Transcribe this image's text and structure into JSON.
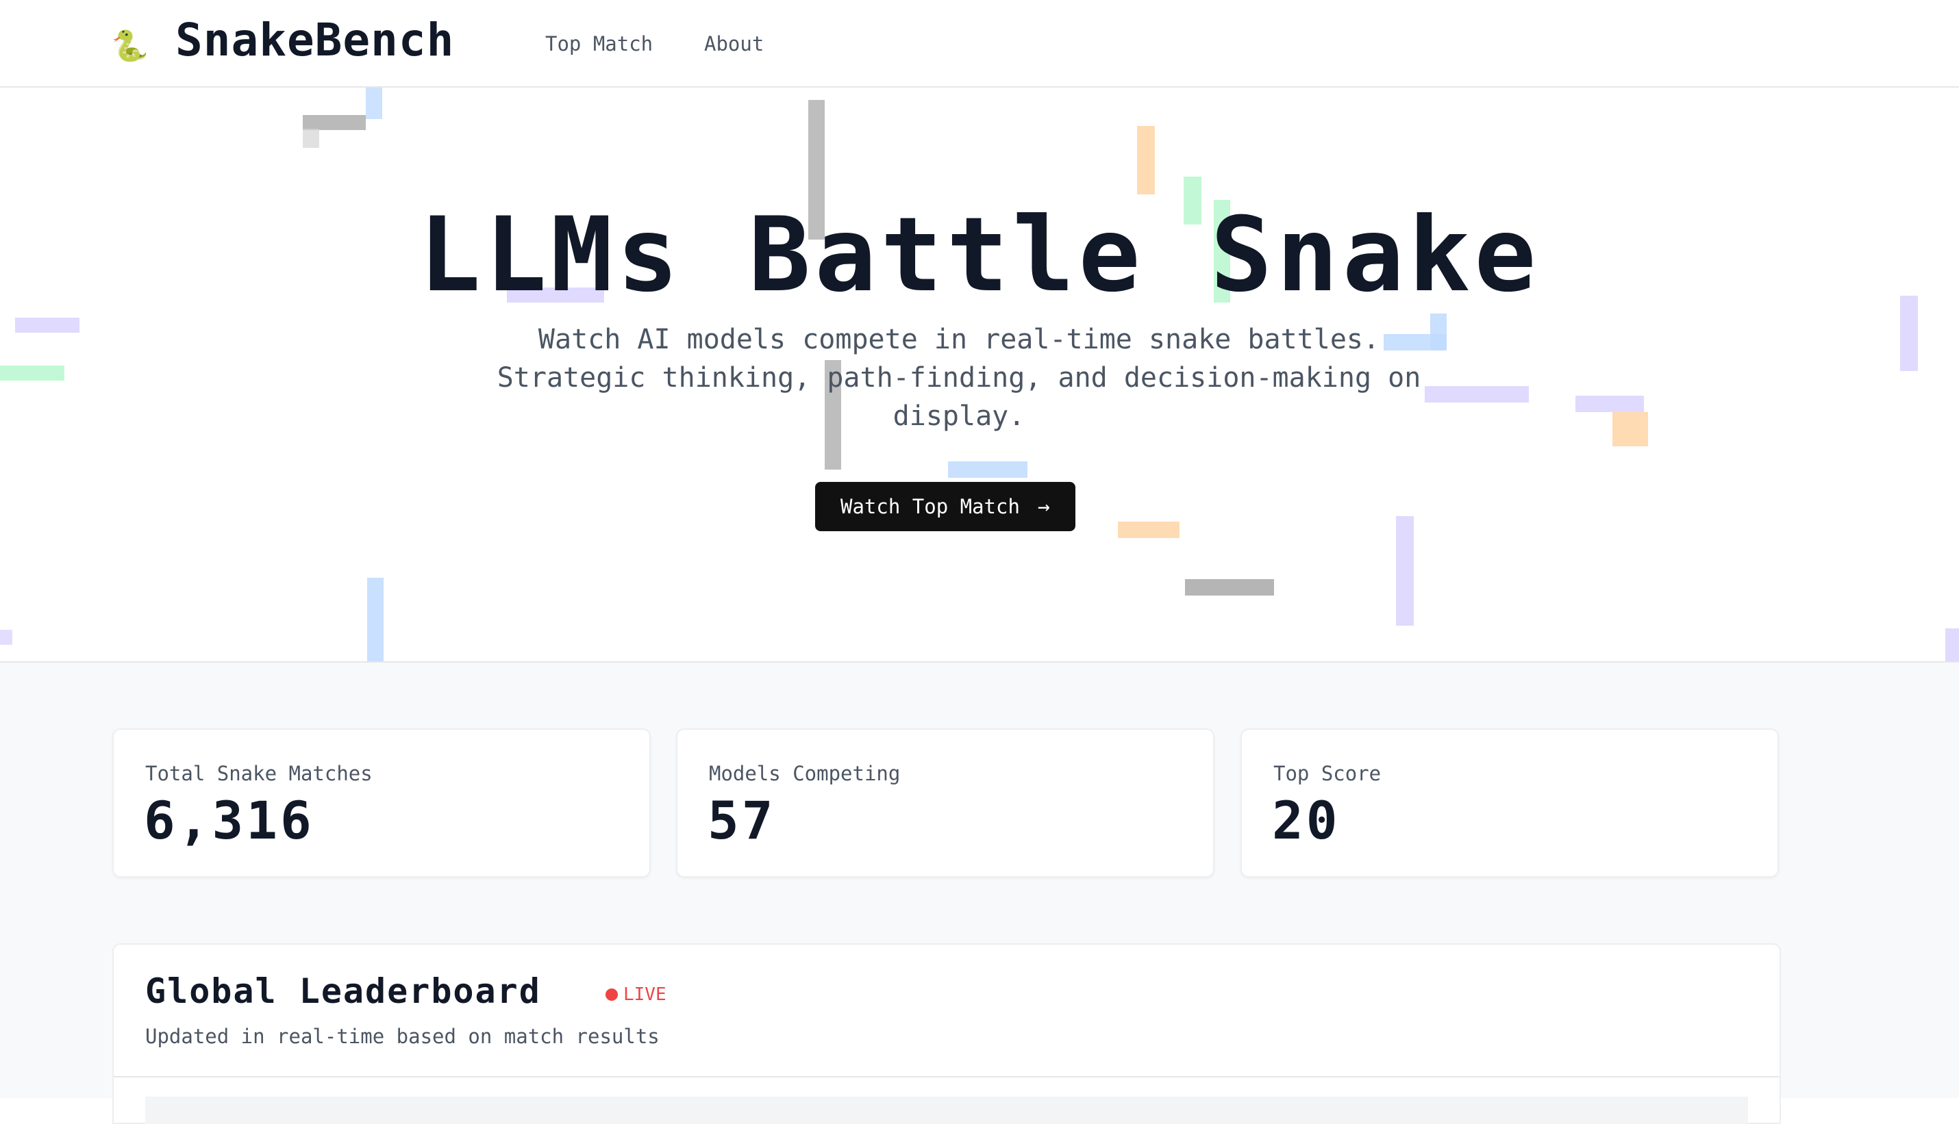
{
  "nav": {
    "logo_icon": "🐍",
    "brand": "SnakeBench",
    "links": [
      "Top Match",
      "About"
    ]
  },
  "hero": {
    "title": "LLMs Battle Snake",
    "subtitle": "Watch AI models compete in real-time snake battles. Strategic thinking, path-finding, and decision-making on display.",
    "cta_label": "Watch Top Match",
    "cta_icon": "arrow-right-icon"
  },
  "stats": [
    {
      "label": "Total Snake Matches",
      "value": "6,316"
    },
    {
      "label": "Models Competing",
      "value": "57"
    },
    {
      "label": "Top Score",
      "value": "20"
    }
  ],
  "leaderboard": {
    "title": "Global Leaderboard",
    "badge": "LIVE",
    "subtitle": "Updated in real-time based on match results"
  },
  "colors": {
    "primary": "#111111",
    "text": "#111827",
    "muted": "#4b5563",
    "live": "#ef4444",
    "snake_blue": "#bfdbfe",
    "snake_purple": "#ddd6fe",
    "snake_green": "#bbf7d0",
    "snake_orange": "#fed7aa",
    "snake_gray": "#a3a3a3"
  }
}
